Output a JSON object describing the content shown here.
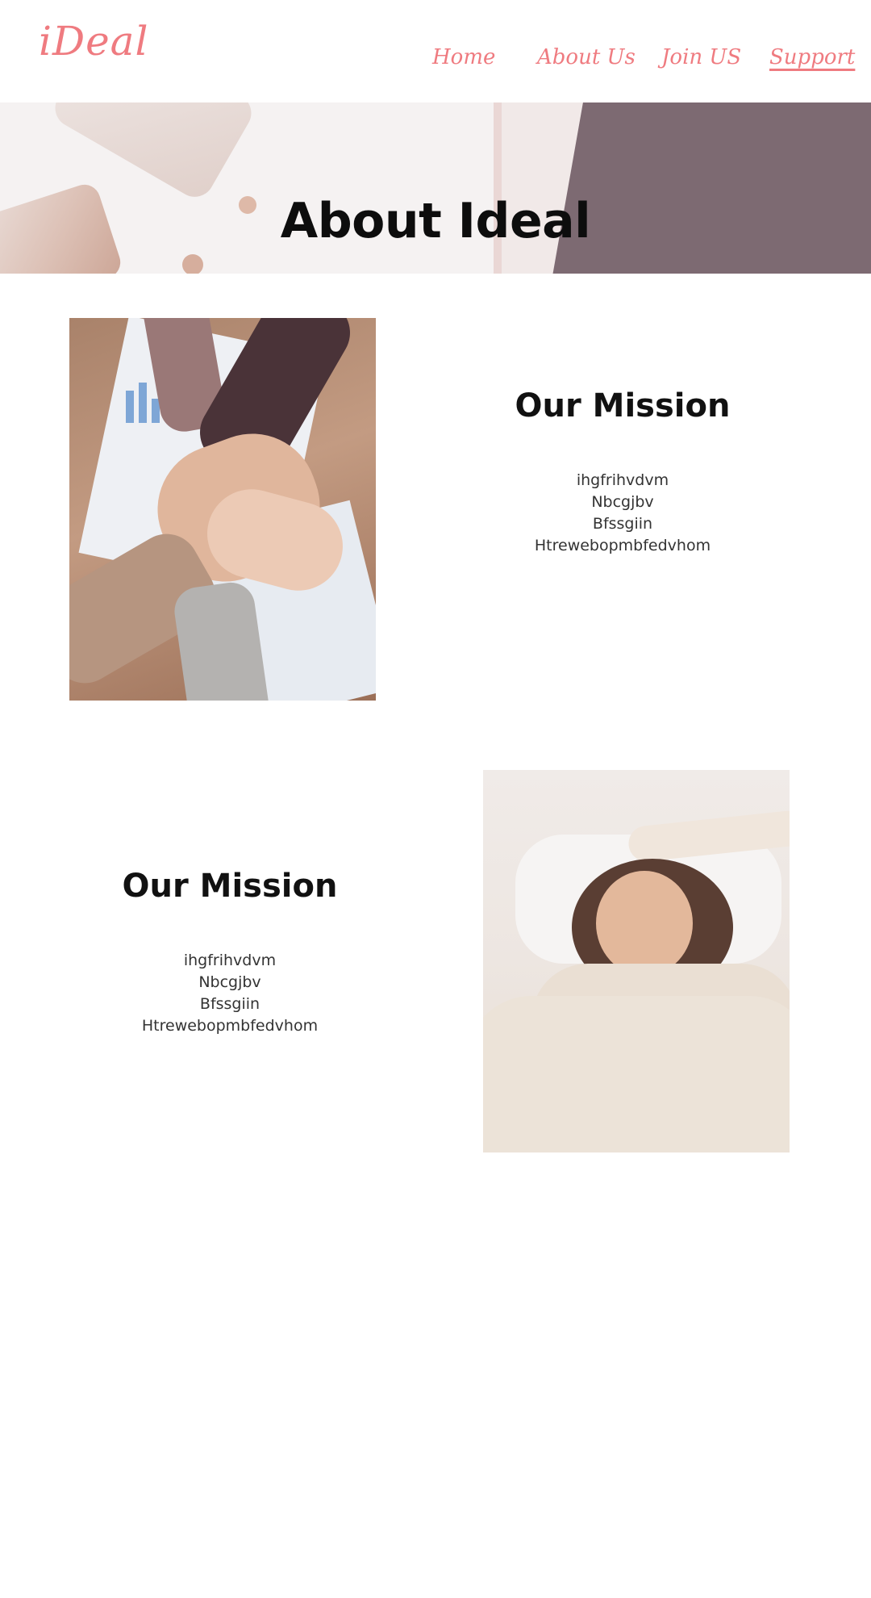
{
  "header": {
    "logo": "iDeal",
    "nav": [
      {
        "label": "Home"
      },
      {
        "label": "About Us"
      },
      {
        "label": "Join US"
      },
      {
        "label": "Support"
      }
    ],
    "brand_color": "#ef7b80"
  },
  "hero": {
    "title": "About Ideal"
  },
  "sections": [
    {
      "heading": "Our Mission",
      "lines": [
        "ihgfrihvdvm",
        "Nbcgjbv",
        "Bfssgiin",
        "Htrewebopmbfedvhom"
      ],
      "photo": "team-hands-photo"
    },
    {
      "heading": "Our Mission",
      "lines": [
        "ihgfrihvdvm",
        "Nbcgjbv",
        "Bfssgiin",
        "Htrewebopmbfedvhom"
      ],
      "photo": "woman-relaxing-photo"
    }
  ]
}
